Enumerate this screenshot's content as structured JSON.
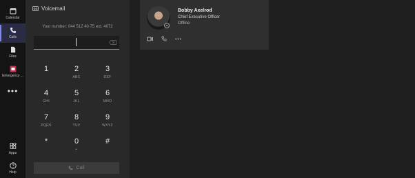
{
  "rail": {
    "items": [
      {
        "label": "Calendar",
        "icon": "calendar-icon"
      },
      {
        "label": "Calls",
        "icon": "phone-icon",
        "active": true
      },
      {
        "label": "Files",
        "icon": "file-icon"
      },
      {
        "label": "Emergency ...",
        "icon": "emergency-app-icon"
      },
      {
        "label": "",
        "icon": "more-icon",
        "glyph": "•••"
      },
      {
        "label": "Apps",
        "icon": "apps-icon"
      },
      {
        "label": "Help",
        "icon": "help-icon"
      }
    ]
  },
  "dialpad": {
    "voicemail_label": "Voicemail",
    "your_number": "Your number: 044 512 40 75 ext. 4072",
    "input_value": "",
    "keys": [
      {
        "digit": "1",
        "letters": ""
      },
      {
        "digit": "2",
        "letters": "ABC"
      },
      {
        "digit": "3",
        "letters": "DEF"
      },
      {
        "digit": "4",
        "letters": "GHI"
      },
      {
        "digit": "5",
        "letters": "JKL"
      },
      {
        "digit": "6",
        "letters": "MNO"
      },
      {
        "digit": "7",
        "letters": "PQRS"
      },
      {
        "digit": "8",
        "letters": "TUV"
      },
      {
        "digit": "9",
        "letters": "WXYZ"
      },
      {
        "digit": "*",
        "letters": ""
      },
      {
        "digit": "0",
        "letters": "+"
      },
      {
        "digit": "#",
        "letters": ""
      }
    ],
    "call_label": "Call"
  },
  "contact": {
    "name": "Bobby Axelrod",
    "title": "Chief Executive Officer",
    "status": "Offline"
  },
  "colors": {
    "accent": "#7f85f5",
    "rail_bg": "#141414",
    "pane_bg": "#292929",
    "card_bg": "#2f2f2f"
  }
}
